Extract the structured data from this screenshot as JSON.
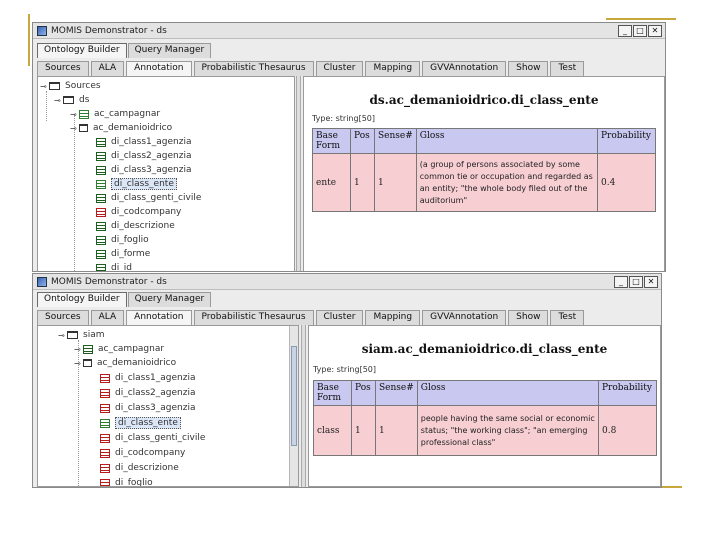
{
  "window1": {
    "title": "MOMIS Demonstrator - ds",
    "main_tabs": [
      "Ontology Builder",
      "Query Manager"
    ],
    "sub_tabs": [
      "Sources",
      "ALA",
      "Annotation",
      "Probabilistic Thesaurus",
      "Cluster",
      "Mapping",
      "GVVAnnotation",
      "Show",
      "Test"
    ],
    "tree": [
      "Sources",
      "ds",
      "ac_campagnar",
      "ac_demanioidrico",
      "di_class1_agenzia",
      "di_class2_agenzia",
      "di_class3_agenzia",
      "di_class_ente",
      "di_class_genti_civile",
      "di_codcompany",
      "di_descrizione",
      "di_foglio",
      "di_forme",
      "di_id"
    ],
    "detail_title": "ds.ac_demanioidrico.di_class_ente",
    "type_text": "Type: string[50]",
    "table_headers": [
      "Base Form",
      "Pos",
      "Sense#",
      "Gloss",
      "Probability"
    ],
    "table_rows": [
      {
        "base_form": "ente",
        "pos": "1",
        "sense": "1",
        "gloss": "(a group of persons associated by some common tie or occupation and regarded as an entity; \"the whole body filed out of the auditorium\"",
        "probability": "0.4"
      }
    ]
  },
  "window2": {
    "title": "MOMIS Demonstrator - ds",
    "main_tabs": [
      "Ontology Builder",
      "Query Manager"
    ],
    "sub_tabs": [
      "Sources",
      "ALA",
      "Annotation",
      "Probabilistic Thesaurus",
      "Cluster",
      "Mapping",
      "GVVAnnotation",
      "Show",
      "Test"
    ],
    "tree": [
      "siam",
      "ac_campagnar",
      "ac_demanioidrico",
      "di_class1_agenzia",
      "di_class2_agenzia",
      "di_class3_agenzia",
      "di_class_ente",
      "di_class_genti_civile",
      "di_codcompany",
      "di_descrizione",
      "di_foglio"
    ],
    "detail_title": "siam.ac_demanioidrico.di_class_ente",
    "type_text": "Type: string[50]",
    "table_headers": [
      "Base Form",
      "Pos",
      "Sense#",
      "Gloss",
      "Probability"
    ],
    "table_rows": [
      {
        "base_form": "class",
        "pos": "1",
        "sense": "1",
        "gloss": "people having the same social or economic status; \"the working class\"; \"an emerging professional class\"",
        "probability": "0.8"
      }
    ]
  },
  "colors": {
    "accent_deco": "#c8a83c",
    "header_bg": "#c8c8f0",
    "row_bg": "#f7cfd3"
  }
}
